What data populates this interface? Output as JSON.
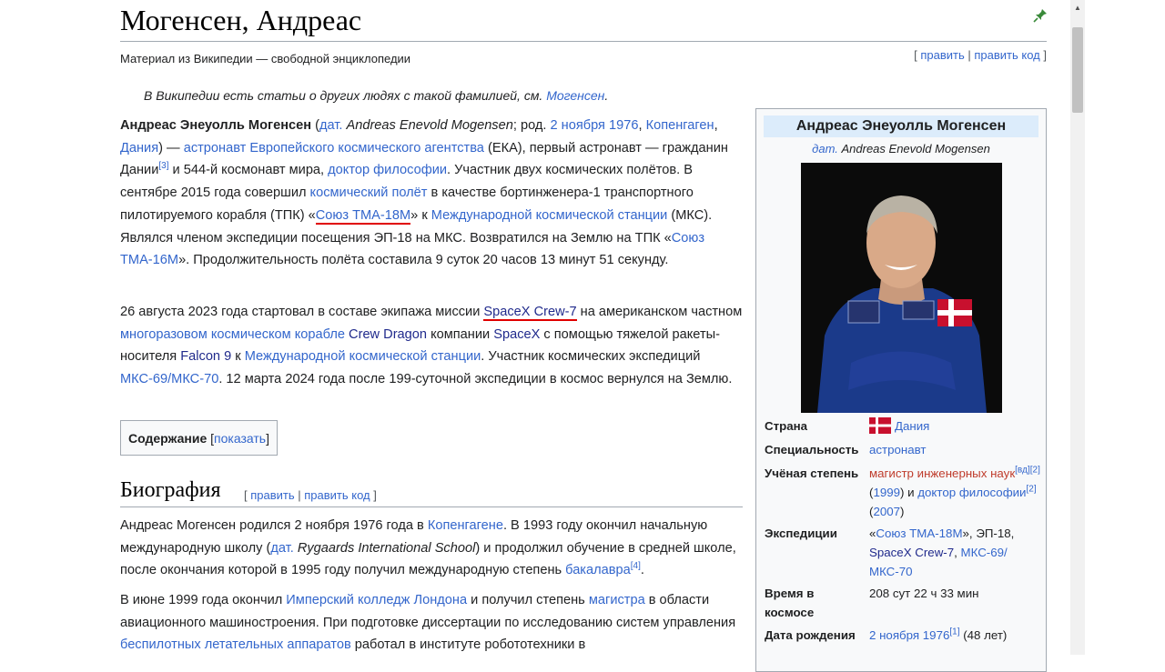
{
  "article": {
    "title": "Могенсен, Андреас",
    "tagline": "Материал из Википедии — свободной энциклопедии",
    "edit_links": {
      "open": "[ ",
      "edit": "править",
      "sep": " | ",
      "edit_code": "править код",
      "close": " ]"
    },
    "hatnote": {
      "text": "В Википедии есть статьи о других людях с такой фамилией, см. ",
      "link": "Могенсен",
      "end": "."
    }
  },
  "lead1": {
    "name": "Андреас Энеуолль Могенсен",
    "t1": " (",
    "lang": "дат.",
    "t2": " ",
    "native": "Andreas Enevold Mogensen",
    "t3": "; род. ",
    "birth": "2 ноября 1976",
    "t4": ", ",
    "city": "Копенгаген",
    "t5": ", ",
    "country": "Дания",
    "t6": ") — ",
    "esa": "астронавт Европейского космического агентства",
    "t7": " (ЕКА), первый астронавт — гражданин Дании",
    "ref3": "[3]",
    "t8": " и 544-й космонавт мира, ",
    "phd": "доктор философии",
    "t9": ". Участник двух космических полётов. В сентябре 2015 года совершил ",
    "flight": "космический полёт",
    "t10": " в качестве бортинженера-1 транспортного пилотируемого корабля (ТПК) «",
    "soyuz18": "Союз ТМА-18М",
    "t11": "» к ",
    "iss": "Международной космической станции",
    "t12": " (МКС). Являлся членом экспедиции посещения ЭП-18 на МКС. Возвратился на Землю на ТПК «",
    "soyuz16": "Союз ТМА-16М",
    "t13": "». Продолжительность полёта составила 9 суток 20 часов 13 минут 51 секунду."
  },
  "lead2": {
    "t1": "26 августа 2023 года стартовал в составе экипажа миссии ",
    "crew7": "SpaceX Crew-7",
    "t2": " на американском частном ",
    "reusable": "многоразовом космическом корабле",
    "t3": " ",
    "dragon": "Crew Dragon",
    "t4": " компании ",
    "spacex": "SpaceX",
    "t5": " с помощью тяжелой ракеты-носителя ",
    "falcon": "Falcon 9",
    "t6": " к ",
    "iss": "Международной космической станции",
    "t7": ". Участник космических экспедиций ",
    "exp": "МКС-69/МКС-70",
    "t8": ". 12 марта 2024 года после 199-суточной экспедиции в космос вернулся на Землю."
  },
  "toc": {
    "title": "Содержание",
    "open": " [",
    "toggle": "показать",
    "close": "]"
  },
  "biography": {
    "heading": "Биография",
    "edit_links": {
      "open": "[ ",
      "edit": "править",
      "sep": " | ",
      "edit_code": "править код",
      "close": " ]"
    },
    "p1": {
      "t1": "Андреас Могенсен родился 2 ноября 1976 года в ",
      "city": "Копенгагене",
      "t2": ". В 1993 году окончил начальную международную школу (",
      "lang": "дат.",
      "t3": " ",
      "school": "Rygaards International School",
      "t4": ") и продолжил обучение в средней школе, после окончания которой в 1995 году получил международную степень ",
      "bachelor": "бакалавра",
      "ref4": "[4]",
      "t5": "."
    },
    "p2": {
      "t1": "В июне 1999 года окончил ",
      "college": "Имперский колледж Лондона",
      "t2": " и получил степень ",
      "master": "магистра",
      "t3": " в области авиационного машиностроения. При подготовке диссертации по исследованию систем управления ",
      "uav": "беспилотных летательных аппаратов",
      "t4": " работал в институте робототехники в"
    }
  },
  "infobox": {
    "title": "Андреас Энеуолль Могенсен",
    "subtitle_lang": "дат.",
    "subtitle_name": " Andreas Enevold Mogensen",
    "rows": {
      "country": {
        "label": "Страна",
        "value": "Дания"
      },
      "specialty": {
        "label": "Специальность",
        "value": "астронавт"
      },
      "degree": {
        "label": "Учёная степень",
        "v1": "магистр инженерных наук",
        "ref_wd": "[вд]",
        "ref2a": "[2]",
        "v2": " (",
        "y1": "1999",
        "v3": ") и ",
        "v4": "доктор философии",
        "ref2b": "[2]",
        "v5": " (",
        "y2": "2007",
        "v6": ")"
      },
      "expeditions": {
        "label": "Экспедиции",
        "q1": "«",
        "soyuz": "Союз ТМА-18М",
        "q2": "», ЭП-18, ",
        "crew": "SpaceX Crew-7",
        "sep": ", ",
        "iss": "МКС-69/ МКС-70"
      },
      "time": {
        "label": "Время в космосе",
        "value": "208 сут 22 ч 33 мин"
      },
      "birth": {
        "label": "Дата рождения",
        "value": "2 ноября 1976",
        "ref": "[1]",
        "age": " (48 лет)"
      }
    }
  },
  "colors": {
    "link": "#3366cc",
    "link_visited": "#202a8c",
    "link_missing": "#bf3c2c",
    "highlight": "#e00000",
    "infobox_title_bg": "#dcecfb"
  },
  "icons": {
    "pin": "pin-icon",
    "scroll": "scroll-up-arrow-icon",
    "flag": "denmark-flag-icon"
  }
}
